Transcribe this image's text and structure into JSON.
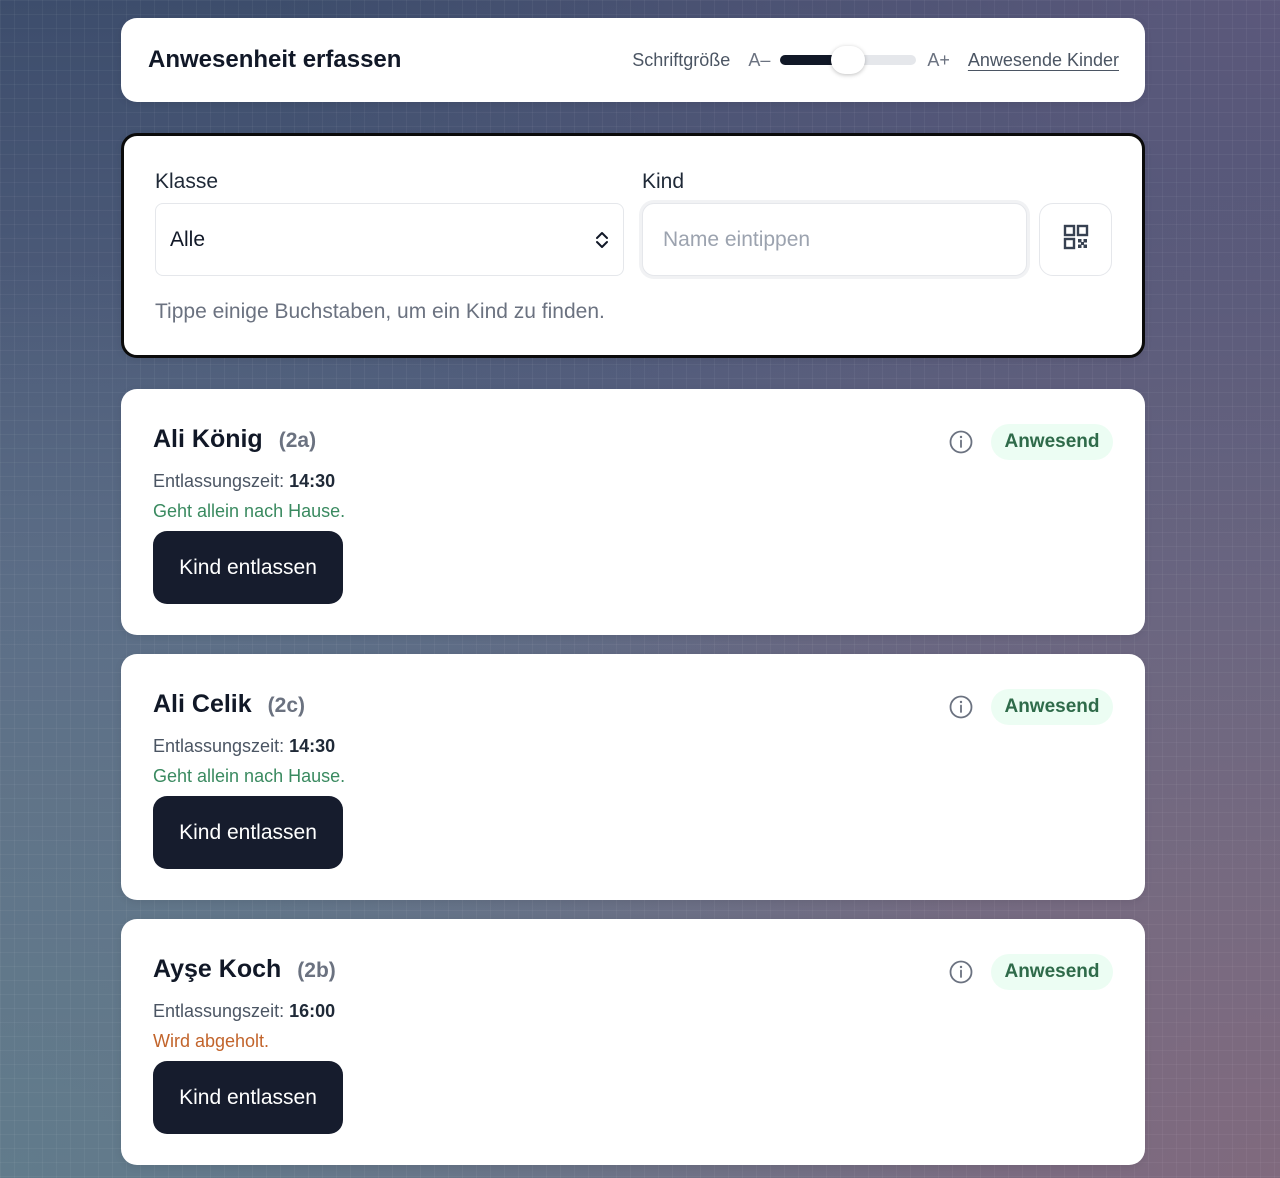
{
  "header": {
    "title": "Anwesenheit erfassen",
    "font_size_label": "Schriftgröße",
    "size_small": "A–",
    "size_large": "A+",
    "font_size_level": 0.5,
    "present_children_link": "Anwesende Kinder"
  },
  "search": {
    "class_label": "Klasse",
    "class_value": "Alle",
    "child_label": "Kind",
    "child_placeholder": "Name eintippen",
    "child_value": "",
    "hint": "Tippe einige Buchstaben, um ein Kind zu finden.",
    "qr_icon": "qr-code-icon"
  },
  "children": [
    {
      "name": "Ali König",
      "class": "(2a)",
      "status": "Anwesend",
      "dismissal_label": "Entlassungszeit:",
      "dismissal_time": "14:30",
      "note": "Geht allein nach Hause.",
      "note_color": "#3a8a60",
      "button": "Kind entlassen"
    },
    {
      "name": "Ali Celik",
      "class": "(2c)",
      "status": "Anwesend",
      "dismissal_label": "Entlassungszeit:",
      "dismissal_time": "14:30",
      "note": "Geht allein nach Hause.",
      "note_color": "#3a8a60",
      "button": "Kind entlassen"
    },
    {
      "name": "Ayşe Koch",
      "class": "(2b)",
      "status": "Anwesend",
      "dismissal_label": "Entlassungszeit:",
      "dismissal_time": "16:00",
      "note": "Wird abgeholt.",
      "note_color": "#c2642b",
      "button": "Kind entlassen"
    }
  ],
  "colors": {
    "primary_button": "#161c2d",
    "status_badge_bg": "#ecfdf3",
    "status_badge_text": "#2f6b4a"
  }
}
